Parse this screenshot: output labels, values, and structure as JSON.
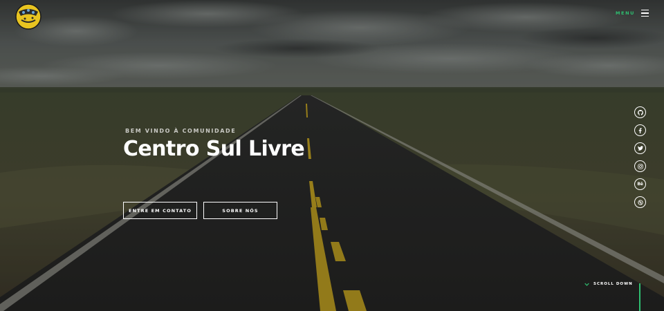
{
  "header": {
    "logo_icon": "sul-livre-logo-icon",
    "menu_label": "MENU",
    "menu_icon": "hamburger-icon",
    "accent_color": "#2fbf71"
  },
  "intro": {
    "kicker": "BEM VINDO À COMUNIDADE",
    "title": "Centro Sul Livre"
  },
  "buttons": {
    "contact_label": "ENTRE EM CONTATO",
    "about_label": "SOBRE NÓS"
  },
  "social": [
    {
      "icon": "github-icon"
    },
    {
      "icon": "facebook-icon"
    },
    {
      "icon": "twitter-icon"
    },
    {
      "icon": "instagram-icon"
    },
    {
      "icon": "behance-icon",
      "text": "Bē"
    },
    {
      "icon": "dribbble-icon"
    }
  ],
  "scroll": {
    "label": "SCROLL DOWN",
    "icon": "chevron-down-icon"
  }
}
